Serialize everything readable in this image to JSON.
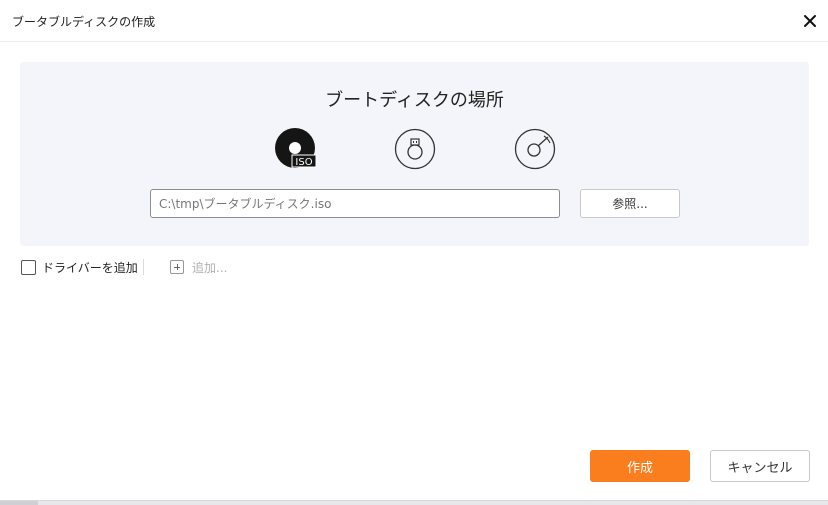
{
  "window": {
    "title": "ブータブルディスクの作成",
    "close_icon": "close-icon"
  },
  "location": {
    "heading": "ブートディスクの場所",
    "targets": [
      {
        "name": "iso",
        "icon": "iso-disc-icon",
        "badge": "ISO",
        "selected": true
      },
      {
        "name": "usb",
        "icon": "usb-drive-icon",
        "selected": false
      },
      {
        "name": "cd",
        "icon": "cd-disc-icon",
        "selected": false
      }
    ],
    "path_value": "C:\\tmp\\ブータブルディスク.iso",
    "browse_label": "参照..."
  },
  "drivers": {
    "checkbox_label": "ドライバーを追加",
    "checked": false,
    "add_label": "追加..."
  },
  "footer": {
    "create_label": "作成",
    "cancel_label": "キャンセル"
  },
  "colors": {
    "accent": "#fa7d1e",
    "panel_bg": "#f4f5fa"
  }
}
